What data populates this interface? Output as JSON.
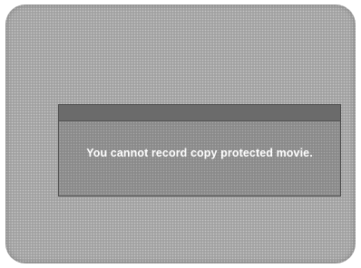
{
  "dialog": {
    "message": "You cannot record copy protected movie."
  },
  "colors": {
    "screen_background": "#a9a9a9",
    "dialog_background": "#8f8f8f",
    "dialog_titlebar": "#6b6b6b",
    "message_text": "#ffffff"
  }
}
